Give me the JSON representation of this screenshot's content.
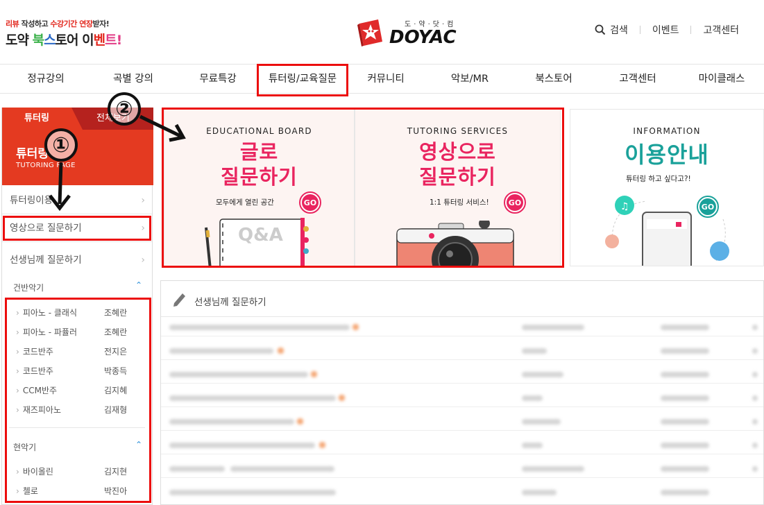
{
  "header": {
    "promo": {
      "part1_red": "리뷰",
      "part1_text": " 작성하고 ",
      "part2_red": "수강기간 연장",
      "part2_text": "받자!",
      "line2_a": "도약 ",
      "line2_b": "북",
      "line2_c": "스",
      "line2_d": "토어 이",
      "line2_e": "벤",
      "line2_f": "트!"
    },
    "logo": {
      "sub": "도·약·닷·컴",
      "main": "DOYAC"
    },
    "util": {
      "search": "검색",
      "event": "이벤트",
      "support": "고객센터"
    }
  },
  "gnb": [
    "정규강의",
    "곡별 강의",
    "무료특강",
    "튜터링/교육질문",
    "커뮤니티",
    "악보/MR",
    "북스토어",
    "고객센터",
    "마이클래스"
  ],
  "sidebar": {
    "tab_active": "튜터링",
    "tab_other": "전체보기",
    "head_title": "튜터링",
    "head_sub": "TUTORING PAGE",
    "links": [
      "튜터링이용",
      "영상으로 질문하기",
      "선생님께 질문하기"
    ],
    "group1": "건반악기",
    "group1_items": [
      {
        "label": "피아노 - 클래식",
        "teacher": "조혜란"
      },
      {
        "label": "피아노 - 파퓰러",
        "teacher": "조혜란"
      },
      {
        "label": "코드반주",
        "teacher": "전지은"
      },
      {
        "label": "코드반주",
        "teacher": "박종득"
      },
      {
        "label": "CCM반주",
        "teacher": "김지혜"
      },
      {
        "label": "재즈피아노",
        "teacher": "김재형"
      }
    ],
    "group2": "현악기",
    "group2_items": [
      {
        "label": "바이올린",
        "teacher": "김지현"
      },
      {
        "label": "첼로",
        "teacher": "박진아"
      }
    ]
  },
  "banners": {
    "b1": {
      "en": "EDUCATIONAL BOARD",
      "line1": "글로",
      "line2": "질문하기",
      "sub": "모두에게 열린 공간",
      "go": "GO"
    },
    "b2": {
      "en": "TUTORING SERVICES",
      "line1": "영상으로",
      "line2": "질문하기",
      "sub": "1:1 튜터링 서비스!",
      "go": "GO"
    },
    "b3": {
      "en": "INFORMATION",
      "line1": "이용안내",
      "sub": "튜터링 하고 싶다고?!",
      "go": "GO"
    },
    "qa_label": "Q&A"
  },
  "board": {
    "title": "선생님께 질문하기"
  },
  "annotations": {
    "one": "①",
    "two": "②"
  },
  "colors": {
    "accent": "#e43a21",
    "highlight": "#ec0d0d",
    "pink": "#e9245f",
    "teal": "#1aa19a"
  }
}
